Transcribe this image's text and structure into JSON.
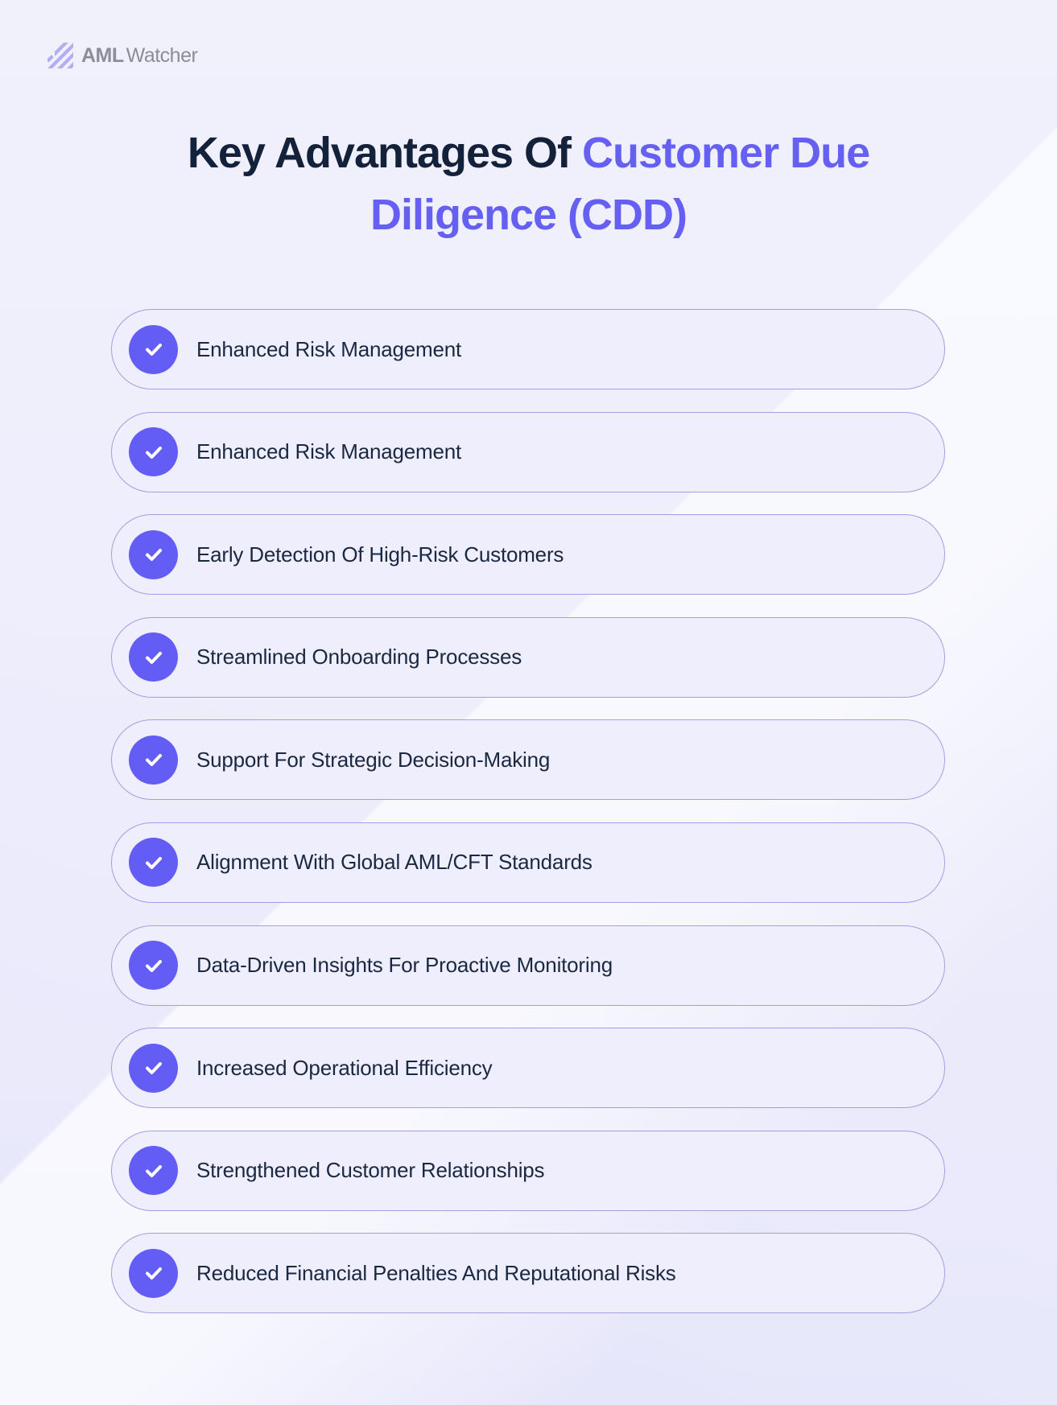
{
  "brand": {
    "name_bold": "AML",
    "name_light": "Watcher",
    "logo_icon": "diagonal-stripes-logo-icon"
  },
  "heading": {
    "part_dark": "Key Advantages Of ",
    "part_accent_line1": "Customer Due",
    "part_accent_line2": "Diligence (CDD)"
  },
  "colors": {
    "accent": "#6560F2",
    "heading_dark": "#14213A",
    "check_circle": "#635DF5",
    "pill_fill": "#EFEEFD",
    "pill_border": "#A29EE3",
    "body_text": "#1B2841",
    "logo_gray": "#8B8E98",
    "logo_icon": "#B3AEF2"
  },
  "advantages": [
    {
      "icon": "check-circle-icon",
      "label": "Enhanced Risk Management"
    },
    {
      "icon": "check-circle-icon",
      "label": "Enhanced Risk Management"
    },
    {
      "icon": "check-circle-icon",
      "label": "Early Detection Of High-Risk Customers"
    },
    {
      "icon": "check-circle-icon",
      "label": "Streamlined Onboarding Processes"
    },
    {
      "icon": "check-circle-icon",
      "label": "Support For Strategic Decision-Making"
    },
    {
      "icon": "check-circle-icon",
      "label": "Alignment With Global AML/CFT Standards"
    },
    {
      "icon": "check-circle-icon",
      "label": "Data-Driven Insights For Proactive Monitoring"
    },
    {
      "icon": "check-circle-icon",
      "label": "Increased Operational Efficiency"
    },
    {
      "icon": "check-circle-icon",
      "label": "Strengthened Customer Relationships"
    },
    {
      "icon": "check-circle-icon",
      "label": "Reduced Financial Penalties And Reputational Risks"
    }
  ]
}
